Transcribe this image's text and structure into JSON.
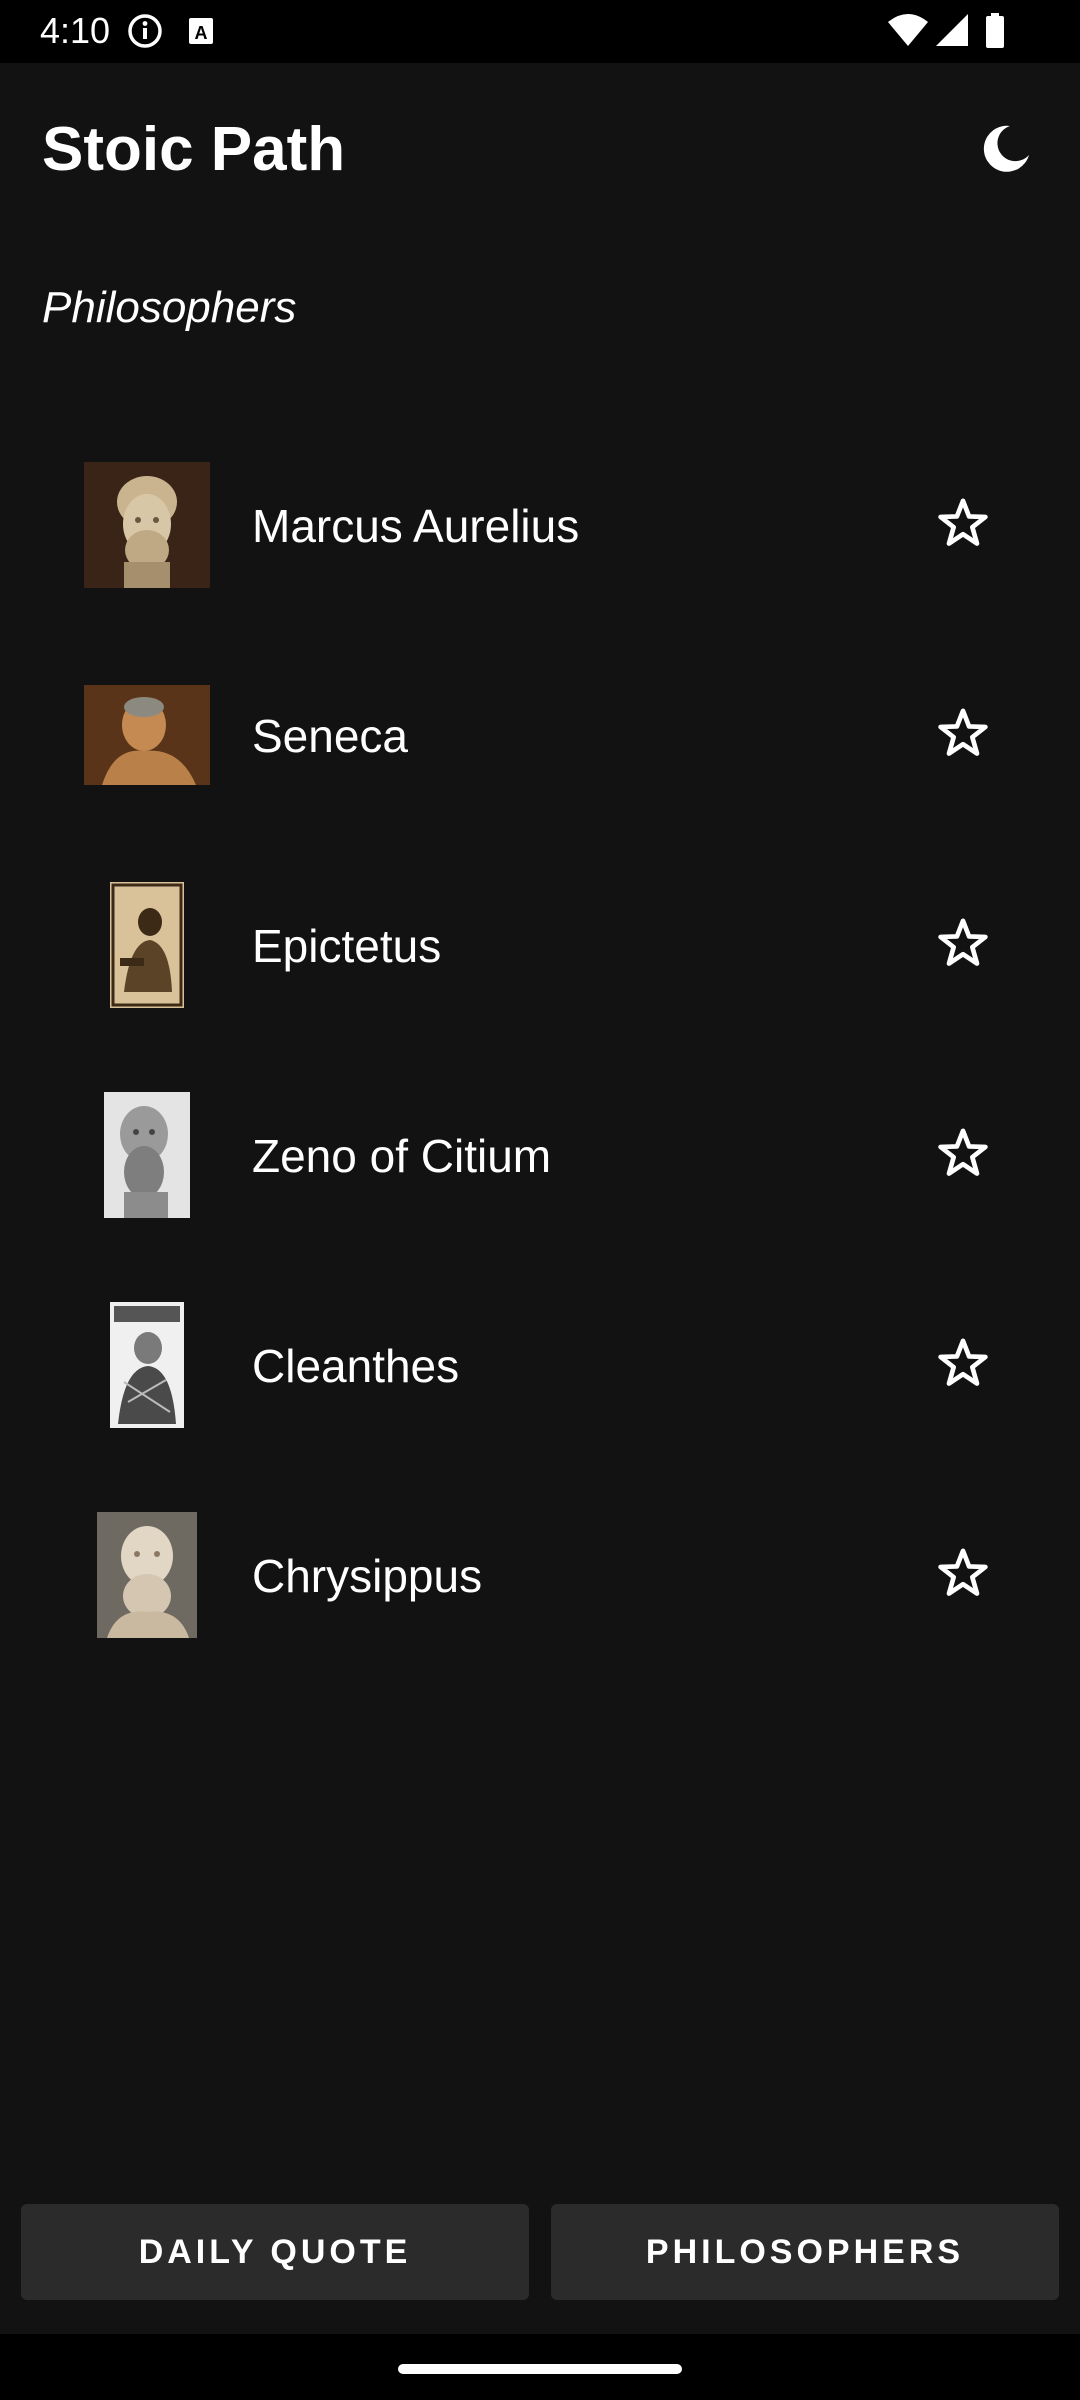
{
  "status_bar": {
    "time": "4:10",
    "icons": [
      "info-icon",
      "a-notification-icon",
      "wifi-icon",
      "cellular-signal-icon",
      "battery-icon"
    ]
  },
  "header": {
    "title": "Stoic Path",
    "theme_icon": "moon-icon"
  },
  "section": {
    "title": "Philosophers"
  },
  "philosophers": [
    {
      "name": "Marcus Aurelius",
      "image": "marcus-aurelius-bust-portrait",
      "favorite": false
    },
    {
      "name": "Seneca",
      "image": "seneca-painting-portrait",
      "favorite": false
    },
    {
      "name": "Epictetus",
      "image": "epictetus-engraving-portrait",
      "favorite": false
    },
    {
      "name": "Zeno of Citium",
      "image": "zeno-of-citium-bust-portrait",
      "favorite": false
    },
    {
      "name": "Cleanthes",
      "image": "cleanthes-engraving-portrait",
      "favorite": false
    },
    {
      "name": "Chrysippus",
      "image": "chrysippus-bust-portrait",
      "favorite": false
    }
  ],
  "bottom_nav": {
    "daily_quote_label": "DAILY QUOTE",
    "philosophers_label": "PHILOSOPHERS"
  },
  "colors": {
    "background": "#121212",
    "button_background": "#2b2b2b",
    "text": "#ffffff"
  }
}
